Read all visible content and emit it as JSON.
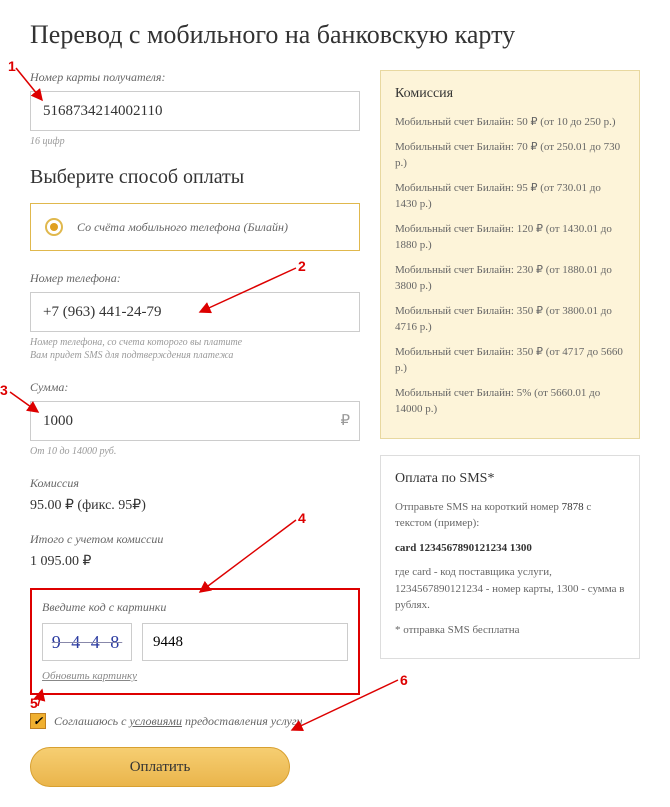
{
  "title": "Перевод с мобильного на банковскую карту",
  "card": {
    "label": "Номер карты получателя:",
    "value": "5168734214002110",
    "hint": "16 цифр"
  },
  "method_section_title": "Выберите способ оплаты",
  "method": {
    "label": "Со счёта мобильного телефона (Билайн)"
  },
  "phone": {
    "label": "Номер телефона:",
    "value": "+7 (963) 441-24-79",
    "hint": "Номер телефона, со счета которого вы платите\nВам придет SMS для подтверждения платежа"
  },
  "amount": {
    "label": "Сумма:",
    "value": "1000",
    "currency": "₽",
    "hint": "От 10 до 14000 руб."
  },
  "commission": {
    "label": "Комиссия",
    "value": "95.00 ₽ (фикс. 95₽)"
  },
  "total": {
    "label": "Итого с учетом комиссии",
    "value": "1 095.00 ₽"
  },
  "captcha": {
    "label": "Введите код с картинки",
    "image_text": "9 4 4 8",
    "value": "9448",
    "refresh": "Обновить картинку"
  },
  "agree": {
    "prefix": "Соглашаюсь с ",
    "link": "условиями",
    "suffix": " предоставления услуги"
  },
  "pay_button": "Оплатить",
  "commission_box": {
    "title": "Комиссия",
    "items": [
      "Мобильный счет Билайн: 50 ₽ (от 10 до 250 р.)",
      "Мобильный счет Билайн: 70 ₽ (от 250.01 до 730 р.)",
      "Мобильный счет Билайн: 95 ₽ (от 730.01 до 1430 р.)",
      "Мобильный счет Билайн: 120 ₽ (от 1430.01 до 1880 р.)",
      "Мобильный счет Билайн: 230 ₽ (от 1880.01 до 3800 р.)",
      "Мобильный счет Билайн: 350 ₽ (от 3800.01 до 4716 р.)",
      "Мобильный счет Билайн: 350 ₽ (от 4717 до 5660 р.)",
      "Мобильный счет Билайн: 5% (от 5660.01 до 14000 р.)"
    ]
  },
  "sms_box": {
    "title": "Оплата по SMS*",
    "line1_a": "Отправьте SMS на короткий номер ",
    "line1_num": "7878",
    "line1_b": " с текстом (пример):",
    "example": "card 1234567890121234 1300",
    "line2": "где card - код поставщика услуги, 1234567890121234 - номер карты, 1300 - сумма в рублях.",
    "line3": "* отправка SMS бесплатна"
  },
  "annotations": [
    "1",
    "2",
    "3",
    "4",
    "5",
    "6"
  ]
}
